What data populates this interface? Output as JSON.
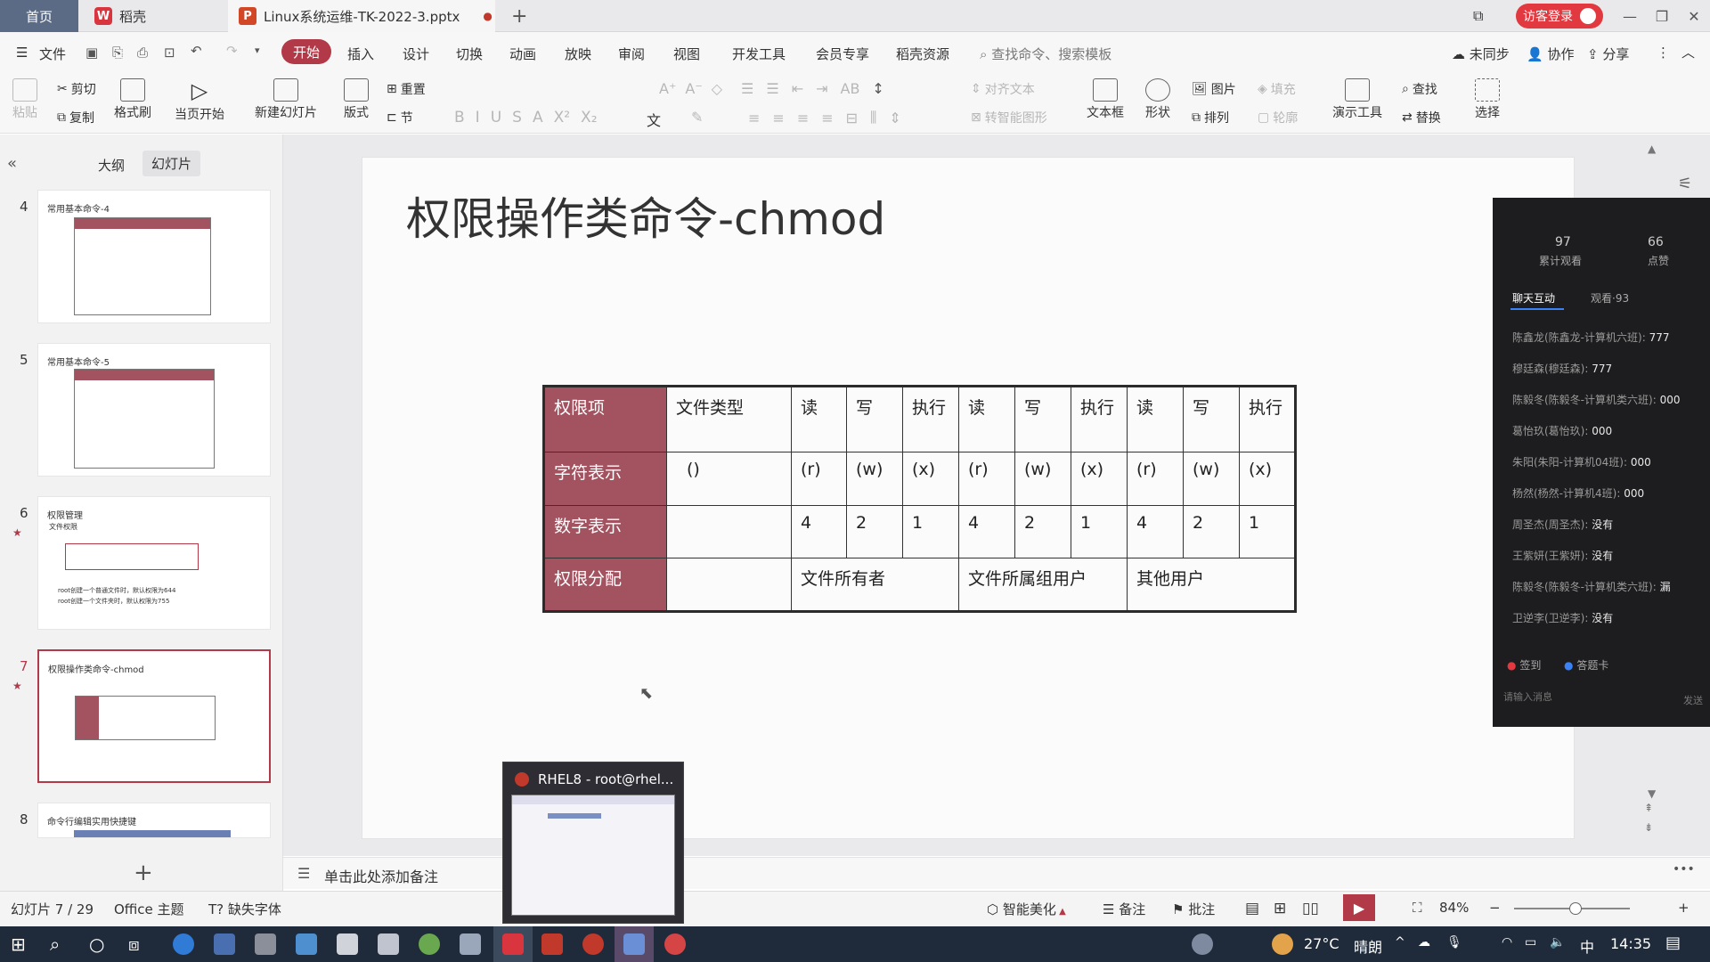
{
  "titlebar": {
    "tab_home": "首页",
    "tab_app": "稻壳",
    "tab_doc": "Linux系统运维-TK-2022-3.pptx",
    "new_tab": "+",
    "login_button": "访客登录"
  },
  "menu": {
    "file": "文件",
    "items": [
      "开始",
      "插入",
      "设计",
      "切换",
      "动画",
      "放映",
      "审阅",
      "视图",
      "开发工具",
      "会员专享",
      "稻壳资源"
    ],
    "search_placeholder": "查找命令、搜索模板",
    "sync": "未同步",
    "collab": "协作",
    "share": "分享"
  },
  "ribbon": {
    "paste": "粘贴",
    "cut": "剪切",
    "copy": "复制",
    "format_painter": "格式刷",
    "from_current": "当页开始",
    "new_slide": "新建幻灯片",
    "layout": "版式",
    "section": "节",
    "reset": "重置",
    "align_text": "对齐文本",
    "to_smartart": "转智能图形",
    "text_box": "文本框",
    "shapes": "形状",
    "picture": "图片",
    "fill": "填充",
    "arrange": "排列",
    "outline": "轮廓",
    "present_tools": "演示工具",
    "find": "查找",
    "replace": "替换",
    "select": "选择"
  },
  "sidebar": {
    "tab_outline": "大纲",
    "tab_slides": "幻灯片",
    "thumbs": [
      {
        "num": "4",
        "title": "常用基本命令-4"
      },
      {
        "num": "5",
        "title": "常用基本命令-5"
      },
      {
        "num": "6",
        "title": "权限管理",
        "sub1": "文件权限",
        "note1": "root创建一个普通文件时，默认权限为644",
        "note2": "root创建一个文件夹时，默认权限为755"
      },
      {
        "num": "7",
        "title": "权限操作类命令-chmod"
      },
      {
        "num": "8",
        "title": "命令行编辑实用快捷键"
      }
    ],
    "add": "+"
  },
  "slide": {
    "title": "权限操作类命令-chmod",
    "table": {
      "row1": [
        "权限项",
        "文件类型",
        "读",
        "写",
        "执行",
        "读",
        "写",
        "执行",
        "读",
        "写",
        "执行"
      ],
      "row2": [
        "字符表示",
        "()",
        "(r)",
        "(w)",
        "(x)",
        "(r)",
        "(w)",
        "(x)",
        "(r)",
        "(w)",
        "(x)"
      ],
      "row3": [
        "数字表示",
        "",
        "4",
        "2",
        "1",
        "4",
        "2",
        "1",
        "4",
        "2",
        "1"
      ],
      "row4": [
        "权限分配",
        "",
        "文件所有者",
        "文件所属组用户",
        "其他用户"
      ]
    }
  },
  "notes_placeholder": "单击此处添加备注",
  "statusbar": {
    "slide_pos": "幻灯片 7 / 29",
    "theme": "Office 主题",
    "missing_font": "缺失字体",
    "beautify": "智能美化",
    "notes": "备注",
    "comments": "批注",
    "zoom": "84%"
  },
  "chat": {
    "views_count": "97",
    "views_label": "累计观看",
    "likes_count": "66",
    "likes_label": "点赞",
    "tab_chat": "聊天互动",
    "tab_viewers": "观看·93",
    "messages": [
      {
        "user": "陈鑫龙(陈鑫龙-计算机六班):",
        "text": "777"
      },
      {
        "user": "穆廷森(穆廷森):",
        "text": "777"
      },
      {
        "user": "陈毅冬(陈毅冬-计算机类六班):",
        "text": "000"
      },
      {
        "user": "葛怡玖(葛怡玖):",
        "text": "000"
      },
      {
        "user": "朱阳(朱阳-计算机04班):",
        "text": "000"
      },
      {
        "user": "杨然(杨然-计算机4班):",
        "text": "000"
      },
      {
        "user": "周圣杰(周圣杰):",
        "text": "没有"
      },
      {
        "user": "王紫妍(王紫妍):",
        "text": "没有"
      },
      {
        "user": "陈毅冬(陈毅冬-计算机类六班):",
        "text": "漏"
      },
      {
        "user": "卫逆李(卫逆李):",
        "text": "没有"
      }
    ],
    "signin": "签到",
    "answer_card": "答题卡",
    "input_placeholder": "请输入消息",
    "send": "发送"
  },
  "popup": {
    "title": "RHEL8 - root@rhel..."
  },
  "taskbar": {
    "temperature": "27°C",
    "weather": "晴朗",
    "ime": "中",
    "time": "14:35"
  }
}
